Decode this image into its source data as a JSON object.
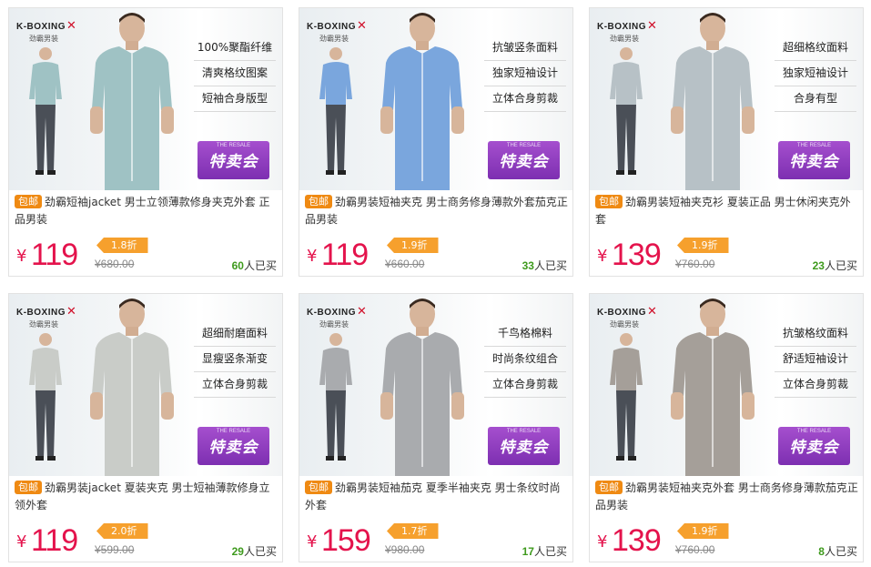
{
  "brand": {
    "name": "K-BOXING",
    "cn": "劲霸男装"
  },
  "sale_badge": {
    "en": "THE RESALE",
    "cn": "特卖会"
  },
  "free_shipping_label": "包邮",
  "sold_suffix": "人已买",
  "currency": "¥",
  "colors": {
    "price": "#e4134c",
    "discount_tag": "#f6a02d",
    "pill": "#ef8a13",
    "sold_count": "#3e9a1d",
    "badge": "#8b3bbd"
  },
  "products": [
    {
      "features": [
        "100%聚酯纤维",
        "清爽格纹图案",
        "短袖合身版型"
      ],
      "title": "劲霸短袖jacket 男士立领薄款修身夹克外套 正品男装",
      "price": "119",
      "discount": "1.8折",
      "original_price": "¥680.00",
      "sold_count": "60",
      "shirt_color": "#9fc2c4"
    },
    {
      "features": [
        "抗皱竖条面料",
        "独家短袖设计",
        "立体合身剪裁"
      ],
      "title": "劲霸男装短袖夹克 男士商务修身薄款外套茄克正品男装",
      "price": "119",
      "discount": "1.9折",
      "original_price": "¥660.00",
      "sold_count": "33",
      "shirt_color": "#7aa6dd"
    },
    {
      "features": [
        "超细格纹面料",
        "独家短袖设计",
        "合身有型"
      ],
      "title": "劲霸男装短袖夹克衫 夏装正品 男士休闲夹克外套",
      "price": "139",
      "discount": "1.9折",
      "original_price": "¥760.00",
      "sold_count": "23",
      "shirt_color": "#b7c1c6"
    },
    {
      "features": [
        "超细耐磨面料",
        "显瘦竖条渐变",
        "立体合身剪裁"
      ],
      "title": "劲霸男装jacket 夏装夹克 男士短袖薄款修身立领外套",
      "price": "119",
      "discount": "2.0折",
      "original_price": "¥599.00",
      "sold_count": "29",
      "shirt_color": "#c9ccc8"
    },
    {
      "features": [
        "千鸟格棉料",
        "时尚条纹组合",
        "立体合身剪裁"
      ],
      "title": "劲霸男装短袖茄克 夏季半袖夹克 男士条纹时尚外套",
      "price": "159",
      "discount": "1.7折",
      "original_price": "¥980.00",
      "sold_count": "17",
      "shirt_color": "#a9abae"
    },
    {
      "features": [
        "抗皱格纹面料",
        "舒适短袖设计",
        "立体合身剪裁"
      ],
      "title": "劲霸男装短袖夹克外套 男士商务修身薄款茄克正品男装",
      "price": "139",
      "discount": "1.9折",
      "original_price": "¥760.00",
      "sold_count": "8",
      "shirt_color": "#a59f99"
    }
  ]
}
